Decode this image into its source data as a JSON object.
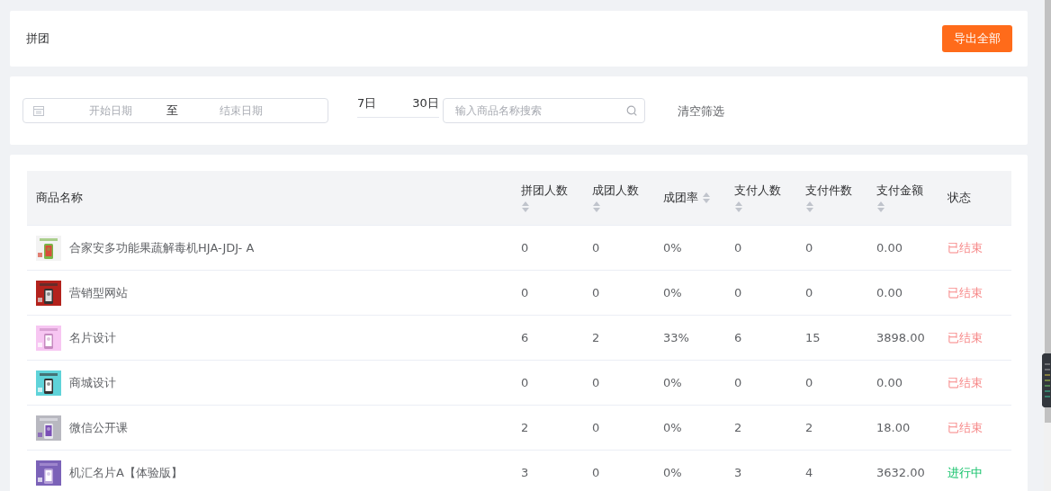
{
  "header": {
    "title": "拼团",
    "export_button": "导出全部"
  },
  "filters": {
    "date_range": {
      "start_placeholder": "开始日期",
      "separator": "至",
      "end_placeholder": "结束日期"
    },
    "quick_ranges": [
      {
        "label": "7日",
        "selected": false
      },
      {
        "label": "30日",
        "selected": false
      }
    ],
    "search": {
      "placeholder": "输入商品名称搜索"
    },
    "clear_link": "清空筛选"
  },
  "table": {
    "columns": [
      {
        "label": "商品名称",
        "sortable": false
      },
      {
        "label": "拼团人数",
        "sortable": true
      },
      {
        "label": "成团人数",
        "sortable": true
      },
      {
        "label": "成团率",
        "sortable": true
      },
      {
        "label": "支付人数",
        "sortable": true
      },
      {
        "label": "支付件数",
        "sortable": true
      },
      {
        "label": "支付金额",
        "sortable": true
      },
      {
        "label": "状态",
        "sortable": false
      }
    ],
    "rows": [
      {
        "kind": "ended",
        "cells": [
          "合家安多功能果蔬解毒机HJA-JDJ- A",
          "0",
          "0",
          "0%",
          "0",
          "0",
          "0.00",
          "已结束"
        ]
      },
      {
        "kind": "ended",
        "cells": [
          "营销型网站",
          "0",
          "0",
          "0%",
          "0",
          "0",
          "0.00",
          "已结束"
        ]
      },
      {
        "kind": "ended",
        "cells": [
          "名片设计",
          "6",
          "2",
          "33%",
          "6",
          "15",
          "3898.00",
          "已结束"
        ]
      },
      {
        "kind": "ended",
        "cells": [
          "商城设计",
          "0",
          "0",
          "0%",
          "0",
          "0",
          "0.00",
          "已结束"
        ]
      },
      {
        "kind": "ended",
        "cells": [
          "微信公开课",
          "2",
          "0",
          "0%",
          "2",
          "2",
          "18.00",
          "已结束"
        ]
      },
      {
        "kind": "ongoing",
        "cells": [
          "机汇名片A【体验版】",
          "3",
          "0",
          "0%",
          "3",
          "4",
          "3632.00",
          "进行中"
        ]
      }
    ]
  }
}
